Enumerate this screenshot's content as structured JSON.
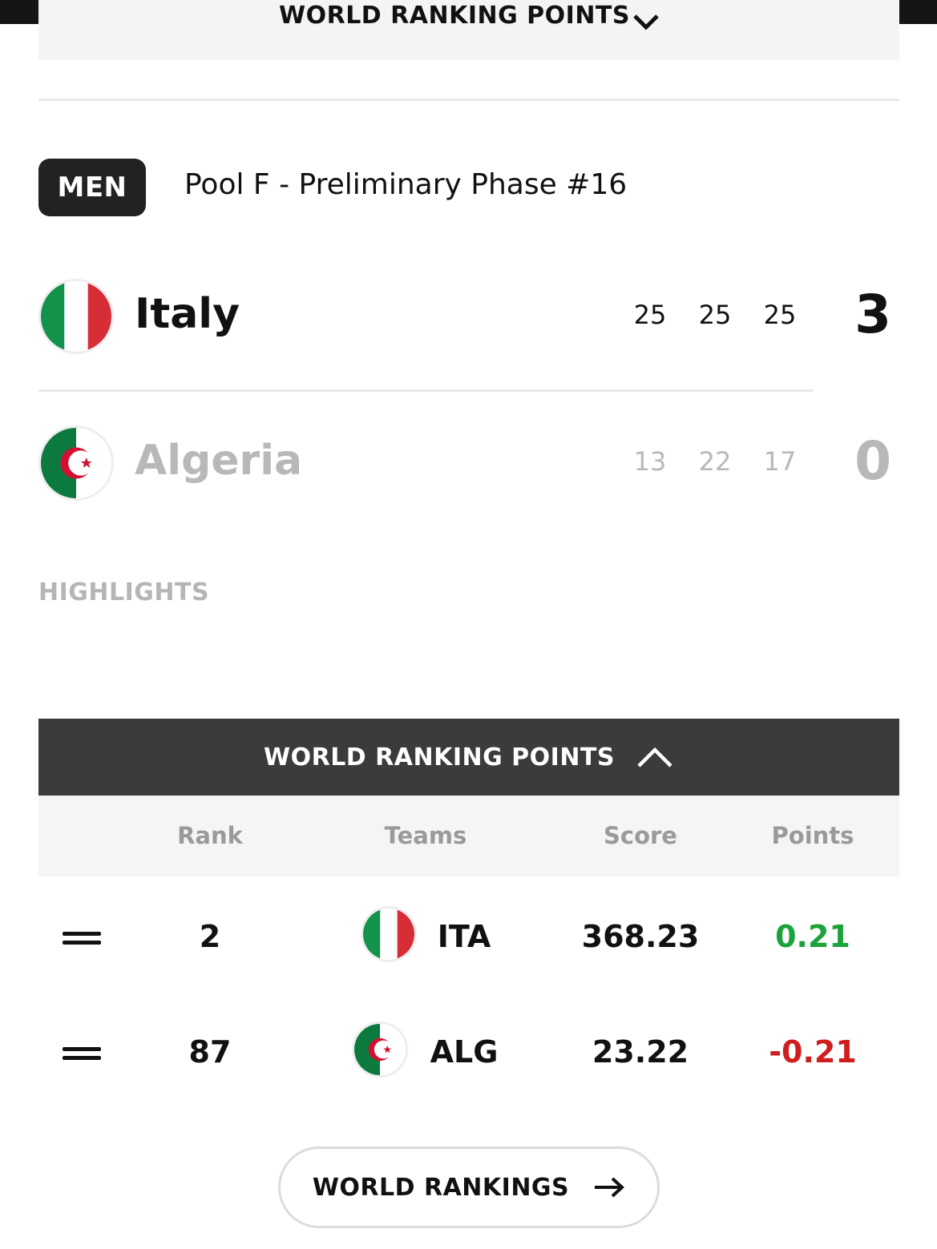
{
  "previous_section": {
    "title": "WORLD RANKING POINTS"
  },
  "match": {
    "gender": "MEN",
    "title": "Pool F - Preliminary Phase #16",
    "teams": [
      {
        "name": "Italy",
        "sets": [
          "25",
          "25",
          "25"
        ],
        "total": "3",
        "flag": "italy-flag"
      },
      {
        "name": "Algeria",
        "sets": [
          "13",
          "22",
          "17"
        ],
        "total": "0",
        "flag": "algeria-flag"
      }
    ]
  },
  "highlights": {
    "label": "HIGHLIGHTS"
  },
  "world_ranking_points": {
    "header": "WORLD RANKING POINTS",
    "columns": [
      "Rank",
      "Teams",
      "Score",
      "Points"
    ],
    "rows": [
      {
        "trend_icon": "equal-icon",
        "rank": "2",
        "flag": "italy-flag",
        "team": "ITA",
        "score": "368.23",
        "points": "0.21"
      },
      {
        "trend_icon": "equal-icon",
        "rank": "87",
        "flag": "algeria-flag",
        "team": "ALG",
        "score": "23.22",
        "points": "-0.21"
      }
    ]
  },
  "world_rankings_button": {
    "label": "WORLD RANKINGS",
    "icon": "arrow-right-icon"
  },
  "colors": {
    "positive": "#1aa33a",
    "negative": "#d01e1e",
    "header_bg": "#3b3b3b",
    "badge_bg": "#222222"
  }
}
